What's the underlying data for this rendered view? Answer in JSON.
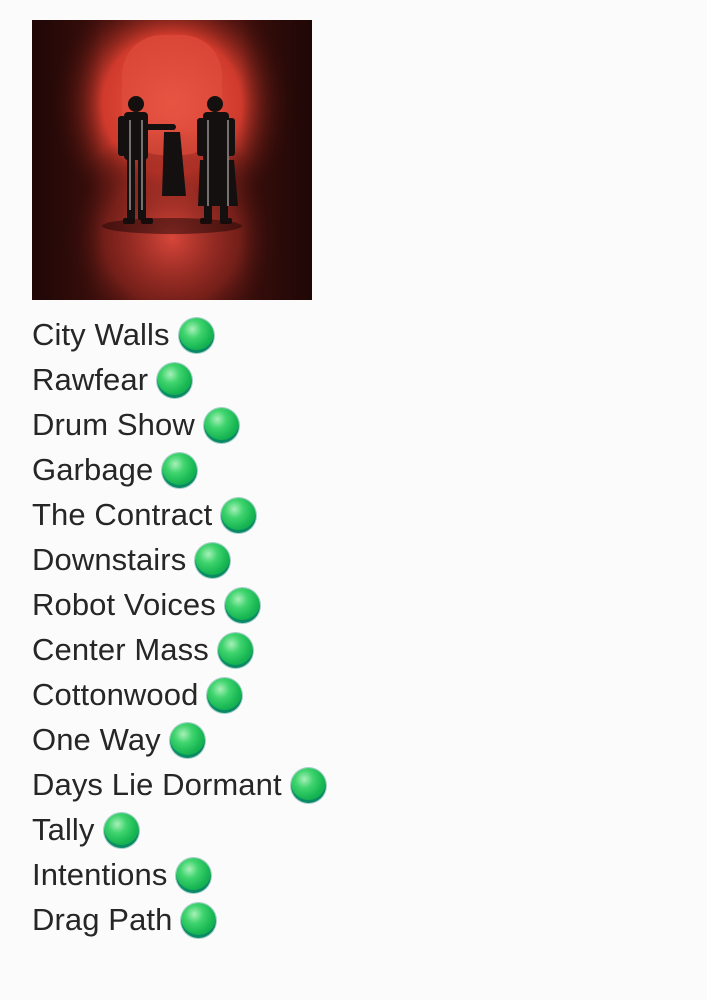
{
  "album": {
    "cover_icon": "album-cover-art",
    "background_color": "#2a0a08",
    "glow_color": "#e0463a"
  },
  "status_color": "#1fbf5a",
  "tracks": [
    {
      "name": "City Walls",
      "status_icon": "green-circle-icon"
    },
    {
      "name": "Rawfear",
      "status_icon": "green-circle-icon"
    },
    {
      "name": "Drum Show",
      "status_icon": "green-circle-icon"
    },
    {
      "name": "Garbage",
      "status_icon": "green-circle-icon"
    },
    {
      "name": "The Contract",
      "status_icon": "green-circle-icon"
    },
    {
      "name": "Downstairs",
      "status_icon": "green-circle-icon"
    },
    {
      "name": "Robot Voices",
      "status_icon": "green-circle-icon"
    },
    {
      "name": "Center Mass",
      "status_icon": "green-circle-icon"
    },
    {
      "name": "Cottonwood",
      "status_icon": "green-circle-icon"
    },
    {
      "name": "One Way",
      "status_icon": "green-circle-icon"
    },
    {
      "name": "Days Lie Dormant",
      "status_icon": "green-circle-icon"
    },
    {
      "name": "Tally",
      "status_icon": "green-circle-icon"
    },
    {
      "name": "Intentions",
      "status_icon": "green-circle-icon"
    },
    {
      "name": "Drag Path",
      "status_icon": "green-circle-icon"
    }
  ]
}
